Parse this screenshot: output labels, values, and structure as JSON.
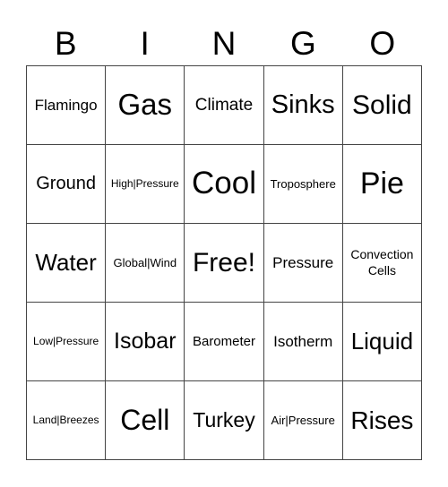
{
  "header": [
    "B",
    "I",
    "N",
    "G",
    "O"
  ],
  "rows": [
    [
      "Flamingo",
      "Gas",
      "Climate",
      "Sinks",
      "Solid"
    ],
    [
      "Ground",
      "High|Pressure",
      "Cool",
      "Troposphere",
      "Pie"
    ],
    [
      "Water",
      "Global|Wind",
      "Free!",
      "Pressure",
      "Convection Cells"
    ],
    [
      "Low|Pressure",
      "Isobar",
      "Barometer",
      "Isotherm",
      "Liquid"
    ],
    [
      "Land|Breezes",
      "Cell",
      "Turkey",
      "Air|Pressure",
      "Rises"
    ]
  ]
}
